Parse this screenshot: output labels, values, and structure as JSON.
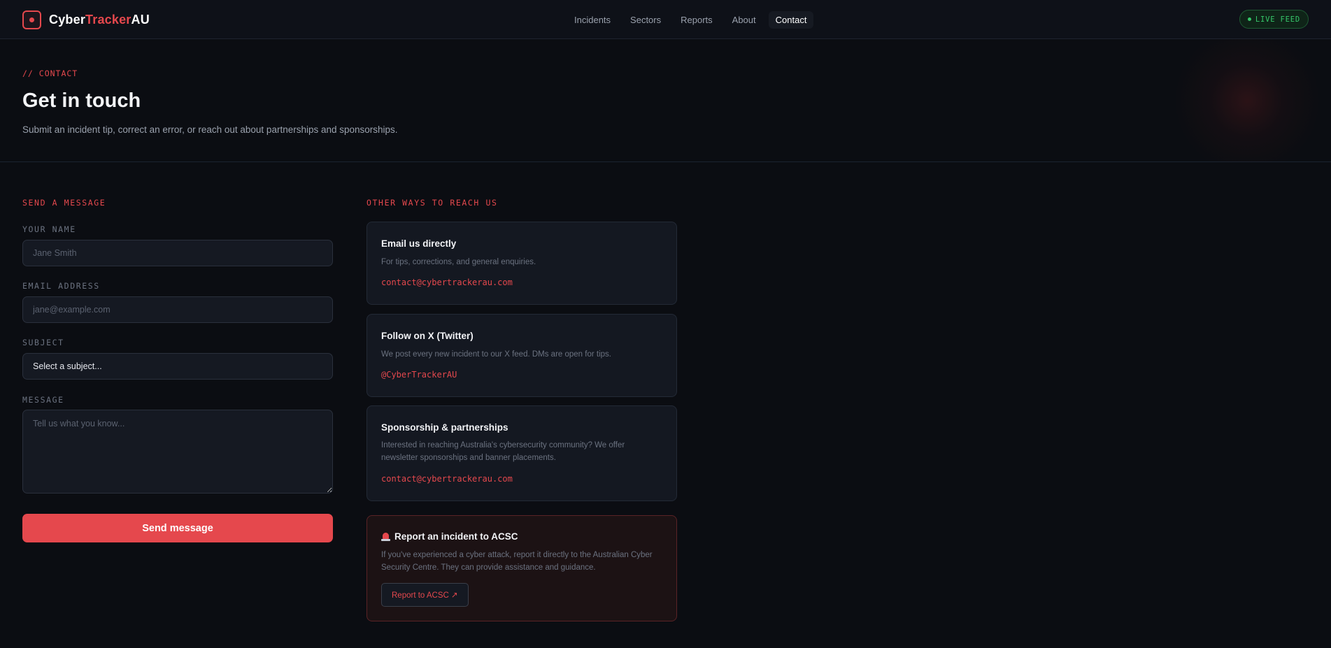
{
  "brand": {
    "part1": "Cyber",
    "part2": "Tracker",
    "part3": "AU",
    "icon": "record-dot-icon"
  },
  "nav": {
    "items": [
      {
        "label": "Incidents",
        "active": false
      },
      {
        "label": "Sectors",
        "active": false
      },
      {
        "label": "Reports",
        "active": false
      },
      {
        "label": "About",
        "active": false
      },
      {
        "label": "Contact",
        "active": true
      }
    ]
  },
  "live_badge": {
    "label": "LIVE FEED",
    "icon": "status-dot-icon"
  },
  "hero": {
    "eyebrow": "// CONTACT",
    "title": "Get in touch",
    "subtitle": "Submit an incident tip, correct an error, or reach out about partnerships and sponsorships."
  },
  "form": {
    "section_label": "SEND A MESSAGE",
    "name_label": "YOUR NAME",
    "name_placeholder": "Jane Smith",
    "email_label": "EMAIL ADDRESS",
    "email_placeholder": "jane@example.com",
    "subject_label": "SUBJECT",
    "subject_value": "Select a subject...",
    "message_label": "MESSAGE",
    "message_placeholder": "Tell us what you know...",
    "submit_label": "Send message"
  },
  "other": {
    "section_label": "OTHER WAYS TO REACH US",
    "cards": [
      {
        "title": "Email us directly",
        "desc": "For tips, corrections, and general enquiries.",
        "link": "contact@cybertrackerau.com"
      },
      {
        "title": "Follow on X (Twitter)",
        "desc": "We post every new incident to our X feed. DMs are open for tips.",
        "link": "@CyberTrackerAU"
      },
      {
        "title": "Sponsorship & partnerships",
        "desc": "Interested in reaching Australia's cybersecurity community? We offer newsletter sponsorships and banner placements.",
        "link": "contact@cybertrackerau.com"
      }
    ],
    "alert": {
      "icon": "siren-icon",
      "title": "Report an incident to ACSC",
      "desc": "If you've experienced a cyber attack, report it directly to the Australian Cyber Security Centre. They can provide assistance and guidance.",
      "button_label": "Report to ACSC ↗"
    }
  },
  "colors": {
    "accent": "#e5484d",
    "background": "#0b0d12",
    "live": "#35c76a"
  }
}
